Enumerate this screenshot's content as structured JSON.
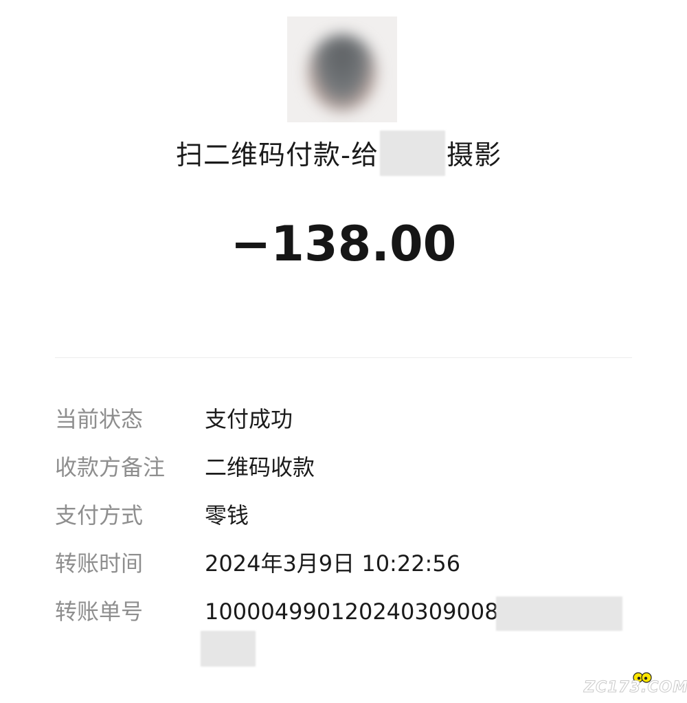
{
  "header": {
    "title_prefix": "扫二维码付款-给",
    "title_suffix": "摄影",
    "amount": "−138.00"
  },
  "details": [
    {
      "label": "当前状态",
      "value": "支付成功"
    },
    {
      "label": "收款方备注",
      "value": "二维码收款"
    },
    {
      "label": "支付方式",
      "value": "零钱"
    },
    {
      "label": "转账时间",
      "value": "2024年3月9日 10:22:56"
    },
    {
      "label": "转账单号",
      "value": "1000049901202403090​08"
    }
  ],
  "watermark": {
    "text": "ZC173.COM"
  },
  "colors": {
    "label": "#8e8e8e",
    "value": "#1a1a1a",
    "divider": "#ececec",
    "redaction": "#e6e6e6"
  }
}
